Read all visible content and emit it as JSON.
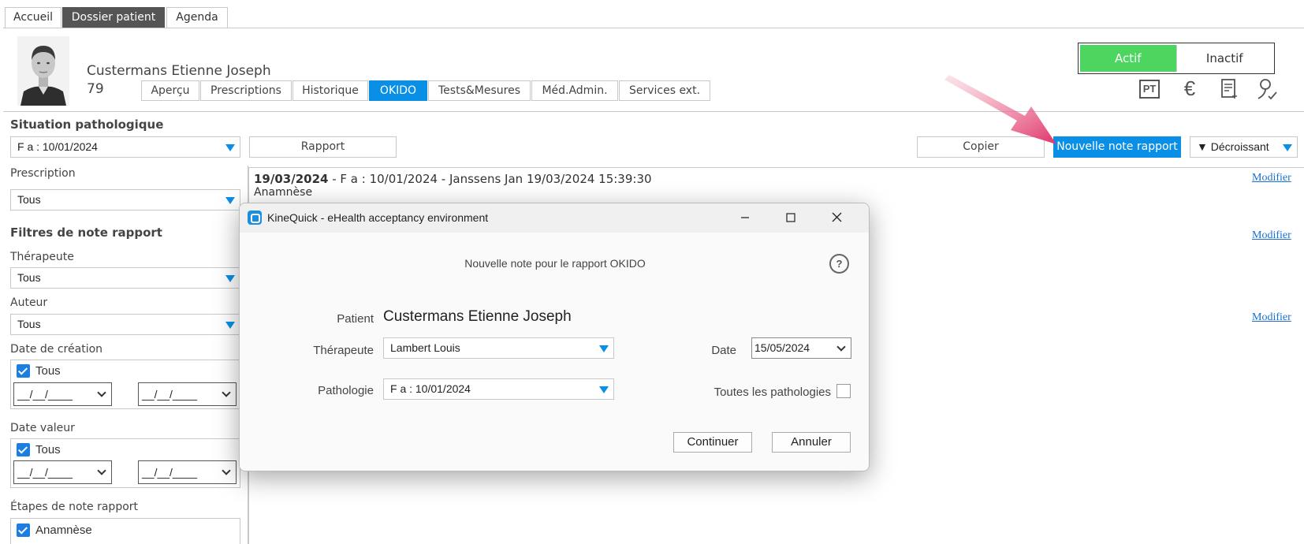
{
  "top_tabs": [
    {
      "label": "Accueil"
    },
    {
      "label": "Dossier patient",
      "active": true
    },
    {
      "label": "Agenda"
    }
  ],
  "patient": {
    "name": "Custermans Etienne Joseph",
    "number": "79"
  },
  "sub_tabs": [
    {
      "label": "Aperçu"
    },
    {
      "label": "Prescriptions"
    },
    {
      "label": "Historique"
    },
    {
      "label": "OKIDO",
      "active": true
    },
    {
      "label": "Tests&Mesures"
    },
    {
      "label": "Méd.Admin."
    },
    {
      "label": "Services ext."
    }
  ],
  "status": {
    "active": "Actif",
    "inactive": "Inactif"
  },
  "toolbar_icons": [
    "pt-icon",
    "euro-icon",
    "document-icon",
    "user-check-icon"
  ],
  "toolbar_pt_label": "PT",
  "toolbar_euro_label": "€",
  "left_panel": {
    "situation_label": "Situation pathologique",
    "situation_value": "F a : 10/01/2024",
    "prescription_label": "Prescription",
    "prescription_value": "Tous",
    "filters_label": "Filtres de note rapport",
    "therapeute_label": "Thérapeute",
    "therapeute_value": "Tous",
    "auteur_label": "Auteur",
    "auteur_value": "Tous",
    "date_creation_label": "Date de création",
    "date_creation_all": "Tous",
    "date_creation_from": "__/__/____",
    "date_creation_to": "__/__/____",
    "date_valeur_label": "Date valeur",
    "date_valeur_all": "Tous",
    "date_valeur_from": "__/__/____",
    "date_valeur_to": "__/__/____",
    "etapes_label": "Étapes de note rapport",
    "etapes_first": "Anamnèse"
  },
  "actions": {
    "rapport": "Rapport",
    "copier": "Copier",
    "nouvelle_note": "Nouvelle note rapport",
    "sort": "▼ Décroissant"
  },
  "entry": {
    "date_bold": "19/03/2024",
    "rest": " - F a : 10/01/2024 - Janssens Jan 19/03/2024 15:39:30",
    "section": "Anamnèse"
  },
  "modifier_label": "Modifier",
  "dialog": {
    "title": "KineQuick - eHealth acceptancy environment",
    "heading": "Nouvelle note pour le rapport OKIDO",
    "help": "?",
    "patient_label": "Patient",
    "patient_value": "Custermans Etienne Joseph",
    "therapeute_label": "Thérapeute",
    "therapeute_value": "Lambert Louis",
    "pathologie_label": "Pathologie",
    "pathologie_value": "F a : 10/01/2024",
    "date_label": "Date",
    "date_value": "15/05/2024",
    "toutes_label": "Toutes les pathologies",
    "continuer": "Continuer",
    "annuler": "Annuler"
  },
  "colors": {
    "accent_blue": "#0a8fe6",
    "active_green": "#4cd660",
    "tab_dark": "#555555",
    "arrow_pink": "#e0336a"
  }
}
